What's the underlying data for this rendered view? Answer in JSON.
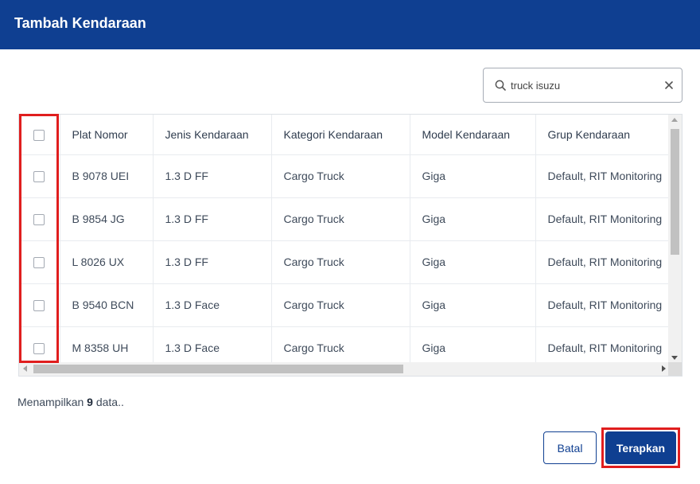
{
  "dialog": {
    "title": "Tambah Kendaraan"
  },
  "search": {
    "value": "truck isuzu"
  },
  "table": {
    "columns": [
      "Plat Nomor",
      "Jenis Kendaraan",
      "Kategori Kendaraan",
      "Model Kendaraan",
      "Grup Kendaraan"
    ],
    "rows": [
      [
        "B 9078 UEI",
        "1.3 D FF",
        "Cargo Truck",
        "Giga",
        "Default, RIT Monitoring"
      ],
      [
        "B 9854 JG",
        "1.3 D FF",
        "Cargo Truck",
        "Giga",
        "Default, RIT Monitoring"
      ],
      [
        "L 8026 UX",
        "1.3 D FF",
        "Cargo Truck",
        "Giga",
        "Default, RIT Monitoring"
      ],
      [
        "B 9540 BCN",
        "1.3 D Face",
        "Cargo Truck",
        "Giga",
        "Default, RIT Monitoring"
      ],
      [
        "M 8358 UH",
        "1.3 D Face",
        "Cargo Truck",
        "Giga",
        "Default, RIT Monitoring"
      ]
    ]
  },
  "footer": {
    "prefix": "Menampilkan",
    "count": "9",
    "suffix": "data.."
  },
  "buttons": {
    "cancel": "Batal",
    "apply": "Terapkan"
  },
  "colors": {
    "header": "#0f3f91",
    "highlight": "#e01e1e"
  }
}
